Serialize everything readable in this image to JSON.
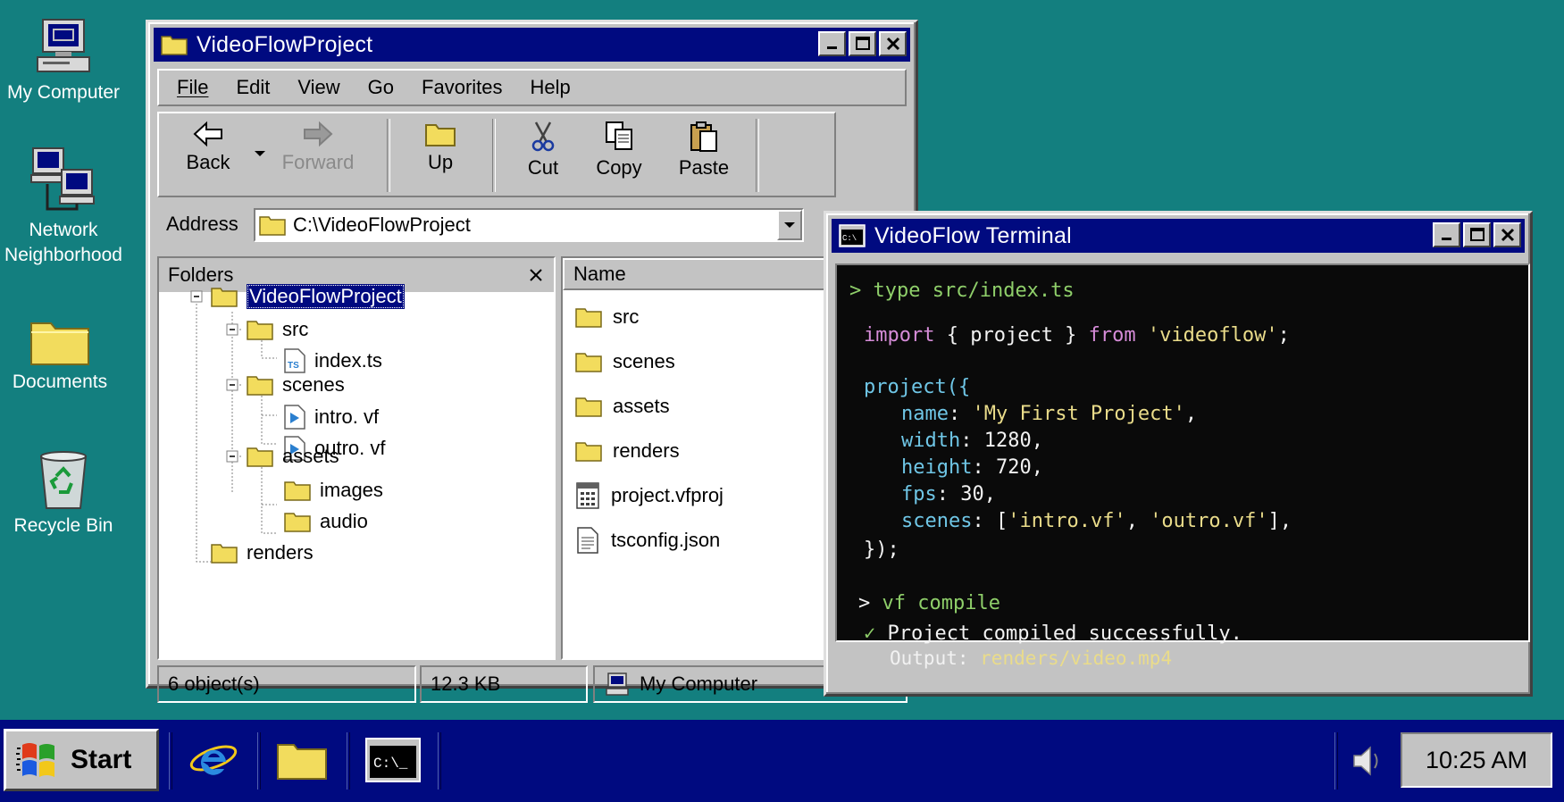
{
  "desktop": {
    "icons": [
      {
        "label_lines": [
          "My Computer"
        ]
      },
      {
        "label_lines": [
          "Network",
          "Neighborhood"
        ]
      },
      {
        "label_lines": [
          "Documents"
        ]
      },
      {
        "label_lines": [
          "Recycle Bin"
        ]
      }
    ]
  },
  "explorer": {
    "title": "VideoFlowProject",
    "menu": [
      "File",
      "Edit",
      "View",
      "Go",
      "Favorites",
      "Help"
    ],
    "toolbar": {
      "back": "Back",
      "forward": "Forward",
      "up": "Up",
      "cut": "Cut",
      "copy": "Copy",
      "paste": "Paste"
    },
    "address_label": "Address",
    "address_value": "C:\\VideoFlowProject",
    "folders_header": "Folders",
    "tree": [
      {
        "label": "VideoFlowProject",
        "icon": "folder-icon",
        "selected": true
      },
      {
        "label": "src",
        "icon": "folder-icon"
      },
      {
        "label": "index.ts",
        "icon": "typescript-file-icon"
      },
      {
        "label": "scenes",
        "icon": "folder-icon"
      },
      {
        "label": "intro. vf",
        "icon": "video-file-icon"
      },
      {
        "label": "outro. vf",
        "icon": "video-file-icon"
      },
      {
        "label": "assets",
        "icon": "folder-icon"
      },
      {
        "label": "images",
        "icon": "folder-icon"
      },
      {
        "label": "audio",
        "icon": "folder-icon"
      },
      {
        "label": "renders",
        "icon": "folder-icon"
      }
    ],
    "list_header": "Name",
    "files": [
      {
        "label": "src",
        "icon": "folder-icon"
      },
      {
        "label": "scenes",
        "icon": "folder-icon"
      },
      {
        "label": "assets",
        "icon": "folder-icon"
      },
      {
        "label": "renders",
        "icon": "folder-icon"
      },
      {
        "label": "project.vfproj",
        "icon": "project-file-icon"
      },
      {
        "label": "tsconfig.json",
        "icon": "document-icon"
      }
    ],
    "status": {
      "objects": "6 object(s)",
      "size": "12.3 KB",
      "location": "My Computer"
    }
  },
  "terminal": {
    "title": "VideoFlow Terminal",
    "prompt1": "> ",
    "cmd1": "type src/index.ts",
    "code": {
      "kw_import": "import",
      "import_mid": " { project } ",
      "kw_from": "from",
      "module": "'videoflow'",
      "semi": ";",
      "call_open": "project({",
      "k_name": "name",
      "v_name": "'My First Project'",
      "k_width": "width",
      "v_width": "1280",
      "k_height": "height",
      "v_height": "720",
      "k_fps": "fps",
      "v_fps": "30",
      "k_scenes": "scenes",
      "v_scene1": "'intro.vf'",
      "v_scene2": "'outro.vf'",
      "call_close": "});"
    },
    "prompt2": "> ",
    "cmd2": "vf compile",
    "check": "✓",
    "success": "Project compiled successfully.",
    "output_label": "Output: ",
    "output_path": "renders/video.mp4"
  },
  "taskbar": {
    "start": "Start",
    "clock": "10:25 AM"
  },
  "colors": {
    "desktop": "#137f7f",
    "titlebar": "#000a80",
    "selection": "#000a80",
    "terminal_green": "#8fcf6a",
    "terminal_yellow": "#eadc8a",
    "terminal_purple": "#d68cd8",
    "terminal_cyan": "#6fc6e6"
  }
}
